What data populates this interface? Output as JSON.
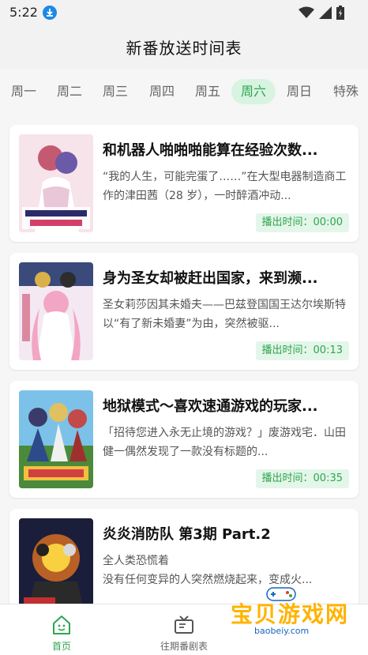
{
  "status_bar": {
    "time": "5:22"
  },
  "header": {
    "title": "新番放送时间表"
  },
  "tabs": [
    "周一",
    "周二",
    "周三",
    "周四",
    "周五",
    "周六",
    "周日",
    "特殊"
  ],
  "active_tab": "周六",
  "cards": [
    {
      "title": "和机器人啪啪啪能算在经验次数...",
      "description": "“我的人生，可能完蛋了……”在大型电器制造商工作的津田茜（28 岁），一时醉酒冲动...",
      "air_time": "播出时间：00:00"
    },
    {
      "title": "身为圣女却被赶出国家，来到濒...",
      "description": "圣女莉莎因其未婚夫——巴兹登国国王达尔埃斯特以“有了新未婚妻”为由，突然被驱...",
      "air_time": "播出时间：00:13"
    },
    {
      "title": "地狱模式～喜欢速通游戏的玩家...",
      "description": "「招待您进入永无止境的游戏？」废游戏宅．山田健一偶然发现了一款没有标题的...",
      "air_time": "播出时间：00:35"
    },
    {
      "title": "炎炎消防队 第3期 Part.2",
      "description": "全人类恐慌着\n没有任何变异的人突然燃烧起来，变成火...",
      "air_time": ""
    }
  ],
  "bottom_nav": [
    {
      "label": "首页",
      "icon": "home-icon"
    },
    {
      "label": "往期番剧表",
      "icon": "tv-icon"
    }
  ],
  "watermark": {
    "main": "宝贝游戏网",
    "sub": "baobeiy.com"
  },
  "colors": {
    "accent": "#2da650",
    "accent_bg": "#d9f3e1"
  }
}
